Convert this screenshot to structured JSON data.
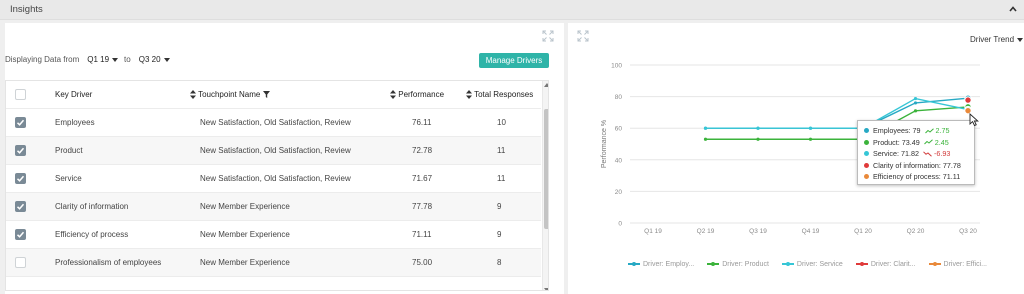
{
  "insights": {
    "title": "Insights"
  },
  "filters": {
    "prefix": "Displaying Data from",
    "from": "Q1 19",
    "to_label": "to",
    "to": "Q3 20"
  },
  "manage_drivers_label": "Manage Drivers",
  "table": {
    "headers": {
      "key_driver": "Key Driver",
      "touchpoint": "Touchpoint Name",
      "performance": "Performance",
      "total_responses": "Total Responses"
    },
    "rows": [
      {
        "checked": true,
        "driver": "Employees",
        "touchpoint": "New Satisfaction, Old Satisfaction, Review",
        "performance": "76.11",
        "responses": "10"
      },
      {
        "checked": true,
        "driver": "Product",
        "touchpoint": "New Satisfaction, Old Satisfaction, Review",
        "performance": "72.78",
        "responses": "11"
      },
      {
        "checked": true,
        "driver": "Service",
        "touchpoint": "New Satisfaction, Old Satisfaction, Review",
        "performance": "71.67",
        "responses": "11"
      },
      {
        "checked": true,
        "driver": "Clarity of information",
        "touchpoint": "New Member Experience",
        "performance": "77.78",
        "responses": "9"
      },
      {
        "checked": true,
        "driver": "Efficiency of process",
        "touchpoint": "New Member Experience",
        "performance": "71.11",
        "responses": "9"
      },
      {
        "checked": false,
        "driver": "Professionalism of employees",
        "touchpoint": "New Member Experience",
        "performance": "75.00",
        "responses": "8"
      }
    ]
  },
  "trend_selector": "Driver Trend",
  "tooltip": [
    {
      "label": "Employees: 79",
      "delta": "2.75",
      "direction": "up",
      "color": "#27a9c4"
    },
    {
      "label": "Product: 73.49",
      "delta": "2.45",
      "direction": "up",
      "color": "#3bb33b"
    },
    {
      "label": "Service: 71.82",
      "delta": "-6.93",
      "direction": "down",
      "color": "#36c6d6"
    },
    {
      "label": "Clarity of information: 77.78",
      "delta": "",
      "direction": "",
      "color": "#e03a3a"
    },
    {
      "label": "Efficiency of process: 71.11",
      "delta": "",
      "direction": "",
      "color": "#e9893a"
    }
  ],
  "chart_data": {
    "type": "line",
    "ylabel": "Performance %",
    "xlabel": "",
    "categories": [
      "Q1 19",
      "Q2 19",
      "Q3 19",
      "Q4 19",
      "Q1 20",
      "Q2 20",
      "Q3 20"
    ],
    "ylim": [
      0,
      100
    ],
    "yticks": [
      0,
      20,
      40,
      60,
      80,
      100
    ],
    "grid": true,
    "legend_position": "bottom",
    "series": [
      {
        "name": "Driver: Employ...",
        "color": "#27a9c4",
        "values": [
          null,
          60,
          60,
          60,
          60,
          76,
          79
        ]
      },
      {
        "name": "Driver: Product",
        "color": "#3bb33b",
        "values": [
          null,
          53,
          53,
          53,
          53,
          71,
          73.49
        ]
      },
      {
        "name": "Driver: Service",
        "color": "#36c6d6",
        "values": [
          null,
          60,
          60,
          60,
          60,
          78.75,
          71.82
        ]
      },
      {
        "name": "Driver: Clarit...",
        "color": "#e03a3a",
        "values": [
          null,
          null,
          null,
          null,
          null,
          null,
          77.78
        ]
      },
      {
        "name": "Driver: Effici...",
        "color": "#e9893a",
        "values": [
          null,
          null,
          null,
          null,
          null,
          null,
          71.11
        ]
      }
    ]
  }
}
